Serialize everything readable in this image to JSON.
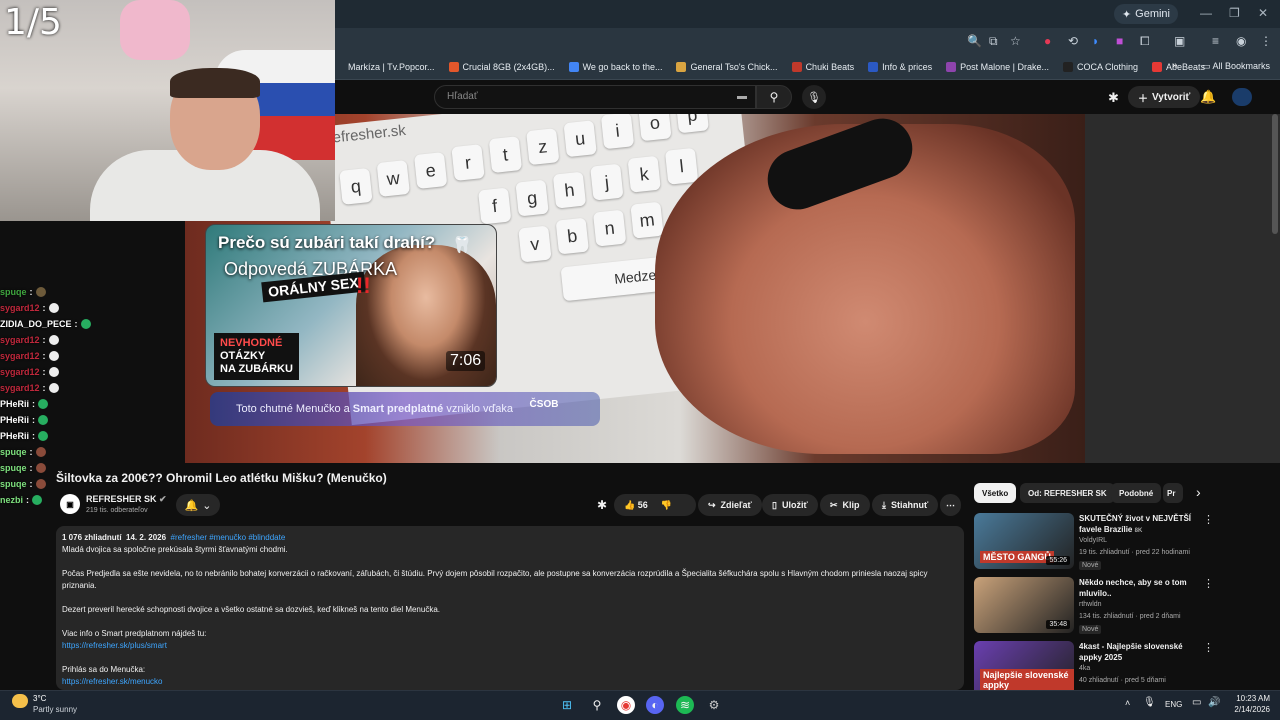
{
  "browser": {
    "gemini_label": "Gemini",
    "bookmarks": [
      {
        "label": "Markíza | Tv.Popcor...",
        "color": "#2a3640"
      },
      {
        "label": "Crucial 8GB (2x4GB)...",
        "color": "#e2572b"
      },
      {
        "label": "We go back to the...",
        "color": "#4285f4"
      },
      {
        "label": "General Tso's Chick...",
        "color": "#d9a441"
      },
      {
        "label": "Chuki Beats",
        "color": "#c0392b"
      },
      {
        "label": "Info & prices",
        "color": "#2b59c3"
      },
      {
        "label": "Post Malone | Drake...",
        "color": "#8e44ad"
      },
      {
        "label": "COCA Clothing",
        "color": "#222222"
      },
      {
        "label": "AbeBeats",
        "color": "#e53935"
      }
    ],
    "all_bookmarks": "All Bookmarks"
  },
  "youtube": {
    "search_placeholder": "Hľadať",
    "create_label": "Vytvoriť"
  },
  "overlay": {
    "counter": "1/5",
    "chat": [
      {
        "user": "spuqe",
        "color": "#3fa63f",
        "emote": "#6d5a3a"
      },
      {
        "user": "sygard12",
        "color": "#c0283c",
        "emote": "#eeeeee"
      },
      {
        "user": "ZIDIA_DO_PECE",
        "color": "#ffffff",
        "emote": "#27ae60"
      },
      {
        "user": "sygard12",
        "color": "#c0283c",
        "emote": "#eeeeee"
      },
      {
        "user": "sygard12",
        "color": "#c0283c",
        "emote": "#eeeeee"
      },
      {
        "user": "sygard12",
        "color": "#c0283c",
        "emote": "#eeeeee"
      },
      {
        "user": "sygard12",
        "color": "#c0283c",
        "emote": "#eeeeee"
      },
      {
        "user": "PHeRii",
        "color": "#ffffff",
        "emote": "#27ae60"
      },
      {
        "user": "PHeRii",
        "color": "#ffffff",
        "emote": "#27ae60"
      },
      {
        "user": "PHeRii",
        "color": "#ffffff",
        "emote": "#27ae60"
      },
      {
        "user": "spuqe",
        "color": "#7ee07e",
        "emote": "#8a4b3a"
      },
      {
        "user": "spuqe",
        "color": "#7ee07e",
        "emote": "#8a4b3a"
      },
      {
        "user": "spuqe",
        "color": "#7ee07e",
        "emote": "#8a4b3a"
      },
      {
        "user": "nezbi",
        "color": "#7ee07e",
        "emote": "#27ae60"
      }
    ]
  },
  "endcard": {
    "title": "Prečo sú zubári takí drahí?",
    "subtitle": "Odpovedá ZUBÁRKA",
    "banner": "ORÁLNY SEX",
    "tag_line1": "NEVHODNÉ",
    "tag_line2": "OTÁZKY",
    "tag_line3": "NA ZUBÁRKU",
    "duration": "7:06"
  },
  "sponsor": {
    "text_pre": "Toto chutné Menučko a ",
    "text_bold": "Smart predplatné",
    "text_post": " vzniklo vďaka",
    "brand": "ČSOB"
  },
  "video": {
    "keyboard_url": "refresher.sk",
    "keyboard_space": "Medzerník",
    "title": "Šiltovka za 200€?? Ohromil Leo atlétku Mišku? (Menučko)",
    "channel": "REFRESHER SK",
    "subscribers": "219 tis. odberateľov",
    "likes": "56",
    "share": "Zdieľať",
    "save": "Uložiť",
    "clip": "Klip",
    "download": "Stiahnuť"
  },
  "description": {
    "views": "1 076 zhliadnutí",
    "date": "14. 2. 2026",
    "tags": "#refresher #menučko #blinddate",
    "p1": "Mladá dvojica sa spoločne prekúsala štyrmi šťavnatými chodmi.",
    "p2": "Počas Predjedla sa ešte nevidela, no to nebránilo bohatej konverzácii o račkovaní, záľubách, či štúdiu. Prvý dojem pôsobil rozpačito, ale postupne sa konverzácia rozprúdila a Špecialita šéfkuchára spolu s Hlavným chodom priniesla naozaj spicy priznania.",
    "p3": "Dezert preveril herecké schopnosti dvojice a všetko ostatné sa dozvieš, keď klikneš na tento diel Menučka.",
    "p4": "Viac info o Smart predplatnom nájdeš tu:",
    "link1": "https://refresher.sk/plus/smart",
    "p5": "Prihlás sa do Menučka:",
    "link2": "https://refresher.sk/menucko"
  },
  "sidebar": {
    "chips": [
      "Všetko",
      "Od: REFRESHER SK",
      "Podobné",
      "Pr"
    ],
    "recs": [
      {
        "title": "SKUTEČNÝ život v NEJVĚTŠÍ favele Brazílie",
        "chan": "VoldyIRL",
        "views": "19 tis. zhliadnutí · pred 22 hodinami",
        "badge": "Nové",
        "dur": "55:26",
        "thumb": "#4a7a9a",
        "thumb_text": "MĚSTO GANGŮ",
        "title_tag": "8K"
      },
      {
        "title": "Někdo nechce, aby se o tom mluvilo..",
        "chan": "rthwldn",
        "views": "134 tis. zhliadnutí · pred 2 dňami",
        "badge": "Nové",
        "dur": "35:48",
        "thumb": "#c9a27a",
        "thumb_text": "",
        "title_tag": ""
      },
      {
        "title": "4kast - Najlepšie slovenské appky 2025",
        "chan": "4ka",
        "views": "40 zhliadnutí · pred 5 dňami",
        "badge": "",
        "dur": "",
        "thumb": "#6a3fb0",
        "thumb_text": "Najlepšie slovenské appky",
        "title_tag": ""
      }
    ]
  },
  "taskbar": {
    "temp": "3°C",
    "weather": "Partly sunny",
    "lang": "ENG",
    "time": "10:23 AM",
    "date": "2/14/2026"
  }
}
